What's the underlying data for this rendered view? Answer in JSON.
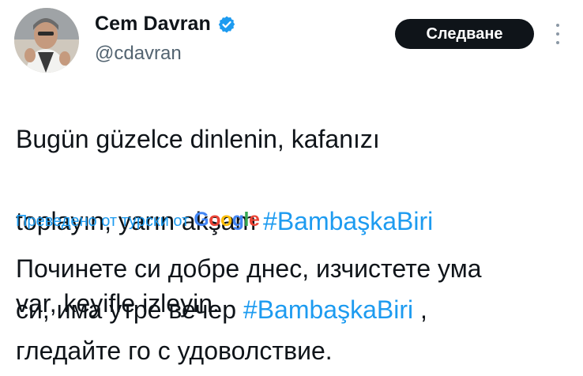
{
  "author": {
    "name": "Cem Davran",
    "handle": "@cdavran",
    "verified": true,
    "avatar_icon": "profile-photo"
  },
  "actions": {
    "follow_label": "Следване",
    "more_icon": "vertical-dots-icon"
  },
  "tweet": {
    "lines": [
      {
        "text": "Bugün güzelce dinlenin, kafanızı",
        "hashtag": ""
      },
      {
        "text": "toplayın, yarın akşam ",
        "hashtag": "#BambaşkaBiri"
      },
      {
        "text": "var, keyifle izleyin.",
        "hashtag": ""
      }
    ]
  },
  "translation": {
    "label": "Преведено от турски от",
    "provider": "Google",
    "lines": [
      {
        "text": "Починете си добре днес, изчистете ума",
        "hashtag": "",
        "after": ""
      },
      {
        "text": "си, има утре вечер ",
        "hashtag": "#BambaşkaBiri",
        "after": " ,"
      },
      {
        "text": "гледайте го с удоволствие.",
        "hashtag": "",
        "after": ""
      }
    ]
  },
  "colors": {
    "link": "#1d9bf0",
    "text": "#0f1419",
    "secondary": "#536471",
    "button_bg": "#0f1419"
  }
}
